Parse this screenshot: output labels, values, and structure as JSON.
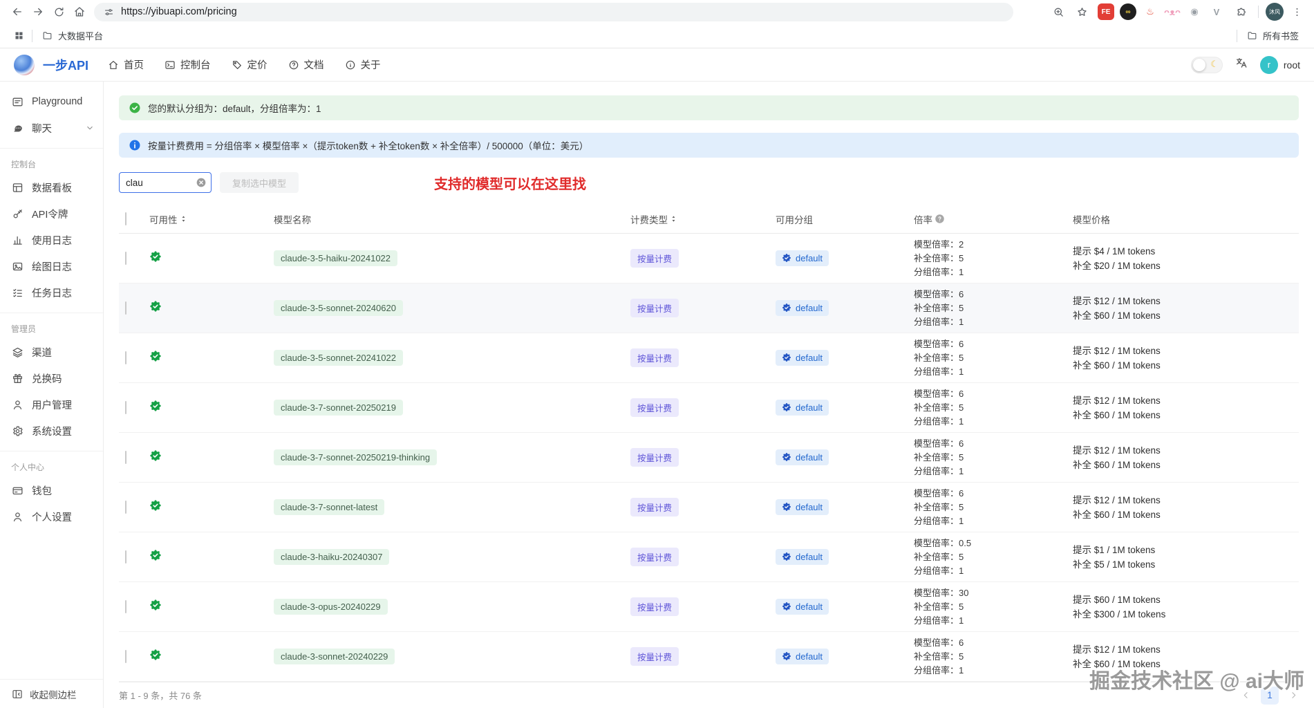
{
  "browser": {
    "url": "https://yibuapi.com/pricing",
    "bookmarks": {
      "folder_label": "大数据平台",
      "all_bookmarks_label": "所有书签"
    },
    "profile_initials": "沐风",
    "extensions": [
      {
        "name": "fe-extension-icon",
        "label": "FE",
        "bg": "#e23e36",
        "fg": "#ffffff",
        "round": false
      },
      {
        "name": "infinity-extension-icon",
        "label": "∞",
        "bg": "#1f1f1f",
        "fg": "#f5d442",
        "round": true
      },
      {
        "name": "red-mascot-extension-icon",
        "label": "♨",
        "bg": "#ffffff",
        "fg": "#e0442f",
        "round": false
      },
      {
        "name": "pink-cat-extension-icon",
        "label": "ᴖᴥᴖ",
        "bg": "#ffffff",
        "fg": "#f0a0bc",
        "round": false
      },
      {
        "name": "gray-badge-extension-icon",
        "label": "◉",
        "bg": "#ffffff",
        "fg": "#9aa0a6",
        "round": false
      },
      {
        "name": "v-extension-icon",
        "label": "V",
        "bg": "#ffffff",
        "fg": "#9aa0a6",
        "round": false
      }
    ]
  },
  "header": {
    "brand": "一步API",
    "nav": [
      {
        "icon": "home-icon",
        "label": "首页"
      },
      {
        "icon": "terminal-icon",
        "label": "控制台"
      },
      {
        "icon": "tag-icon",
        "label": "定价"
      },
      {
        "icon": "question-circle-icon",
        "label": "文档"
      },
      {
        "icon": "info-circle-icon",
        "label": "关于"
      }
    ],
    "user": {
      "initial": "r",
      "name": "root"
    }
  },
  "sidebar": {
    "groups": [
      {
        "section": "",
        "items": [
          {
            "icon": "playground-icon",
            "label": "Playground",
            "chevron": false
          },
          {
            "icon": "chat-icon",
            "label": "聊天",
            "chevron": true
          }
        ]
      },
      {
        "section": "控制台",
        "items": [
          {
            "icon": "dashboard-icon",
            "label": "数据看板"
          },
          {
            "icon": "key-icon",
            "label": "API令牌"
          },
          {
            "icon": "bar-chart-icon",
            "label": "使用日志"
          },
          {
            "icon": "image-icon",
            "label": "绘图日志"
          },
          {
            "icon": "task-list-icon",
            "label": "任务日志"
          }
        ]
      },
      {
        "section": "管理员",
        "items": [
          {
            "icon": "layers-icon",
            "label": "渠道"
          },
          {
            "icon": "gift-icon",
            "label": "兑换码"
          },
          {
            "icon": "user-icon",
            "label": "用户管理"
          },
          {
            "icon": "gear-icon",
            "label": "系统设置"
          }
        ]
      },
      {
        "section": "个人中心",
        "items": [
          {
            "icon": "wallet-icon",
            "label": "钱包"
          },
          {
            "icon": "person-icon",
            "label": "个人设置"
          }
        ]
      }
    ],
    "collapse_label": "收起侧边栏"
  },
  "alerts": {
    "default_group": "您的默认分组为：default，分组倍率为：1",
    "billing_formula": "按量计费费用 = 分组倍率 × 模型倍率 ×（提示token数 + 补全token数 × 补全倍率）/ 500000（单位：美元）"
  },
  "toolbar": {
    "search_value": "clau",
    "copy_button_label": "复制选中模型",
    "annotation": "支持的模型可以在这里找"
  },
  "table": {
    "columns": [
      {
        "label": "可用性",
        "sortable": true
      },
      {
        "label": "模型名称",
        "sortable": false
      },
      {
        "label": "计费类型",
        "sortable": true
      },
      {
        "label": "可用分组",
        "sortable": false
      },
      {
        "label": "倍率",
        "help": true
      },
      {
        "label": "模型价格",
        "sortable": false
      }
    ],
    "ratio_labels": {
      "model": "模型倍率",
      "completion": "补全倍率",
      "group": "分组倍率"
    },
    "rows": [
      {
        "model": "claude-3-5-haiku-20241022",
        "billing": "按量计费",
        "group": "default",
        "ratios": {
          "model": "2",
          "completion": "5",
          "group": "1"
        },
        "prices": [
          "提示 $4 / 1M tokens",
          "补全 $20 / 1M tokens"
        ],
        "highlighted": false
      },
      {
        "model": "claude-3-5-sonnet-20240620",
        "billing": "按量计费",
        "group": "default",
        "ratios": {
          "model": "6",
          "completion": "5",
          "group": "1"
        },
        "prices": [
          "提示 $12 / 1M tokens",
          "补全 $60 / 1M tokens"
        ],
        "highlighted": true
      },
      {
        "model": "claude-3-5-sonnet-20241022",
        "billing": "按量计费",
        "group": "default",
        "ratios": {
          "model": "6",
          "completion": "5",
          "group": "1"
        },
        "prices": [
          "提示 $12 / 1M tokens",
          "补全 $60 / 1M tokens"
        ],
        "highlighted": false
      },
      {
        "model": "claude-3-7-sonnet-20250219",
        "billing": "按量计费",
        "group": "default",
        "ratios": {
          "model": "6",
          "completion": "5",
          "group": "1"
        },
        "prices": [
          "提示 $12 / 1M tokens",
          "补全 $60 / 1M tokens"
        ],
        "highlighted": false
      },
      {
        "model": "claude-3-7-sonnet-20250219-thinking",
        "billing": "按量计费",
        "group": "default",
        "ratios": {
          "model": "6",
          "completion": "5",
          "group": "1"
        },
        "prices": [
          "提示 $12 / 1M tokens",
          "补全 $60 / 1M tokens"
        ],
        "highlighted": false
      },
      {
        "model": "claude-3-7-sonnet-latest",
        "billing": "按量计费",
        "group": "default",
        "ratios": {
          "model": "6",
          "completion": "5",
          "group": "1"
        },
        "prices": [
          "提示 $12 / 1M tokens",
          "补全 $60 / 1M tokens"
        ],
        "highlighted": false
      },
      {
        "model": "claude-3-haiku-20240307",
        "billing": "按量计费",
        "group": "default",
        "ratios": {
          "model": "0.5",
          "completion": "5",
          "group": "1"
        },
        "prices": [
          "提示 $1 / 1M tokens",
          "补全 $5 / 1M tokens"
        ],
        "highlighted": false
      },
      {
        "model": "claude-3-opus-20240229",
        "billing": "按量计费",
        "group": "default",
        "ratios": {
          "model": "30",
          "completion": "5",
          "group": "1"
        },
        "prices": [
          "提示 $60 / 1M tokens",
          "补全 $300 / 1M tokens"
        ],
        "highlighted": false
      },
      {
        "model": "claude-3-sonnet-20240229",
        "billing": "按量计费",
        "group": "default",
        "ratios": {
          "model": "6",
          "completion": "5",
          "group": "1"
        },
        "prices": [
          "提示 $12 / 1M tokens",
          "补全 $60 / 1M tokens"
        ],
        "highlighted": false
      }
    ]
  },
  "footer": {
    "summary": "第 1 - 9 条，共 76 条",
    "page": "1"
  },
  "watermark": "掘金技术社区 @ ai大师",
  "colors": {
    "brand": "#2968d4",
    "success": "#3bb346",
    "info": "#2173e8",
    "annotation": "#e02b2b",
    "tag_green_bg": "#e6f5ea",
    "tag_green_fg": "#44604d",
    "tag_violet_bg": "#ebe9fc",
    "tag_violet_fg": "#5f55d8",
    "tag_blue_bg": "#e3eefb",
    "tag_blue_fg": "#2368cf"
  }
}
